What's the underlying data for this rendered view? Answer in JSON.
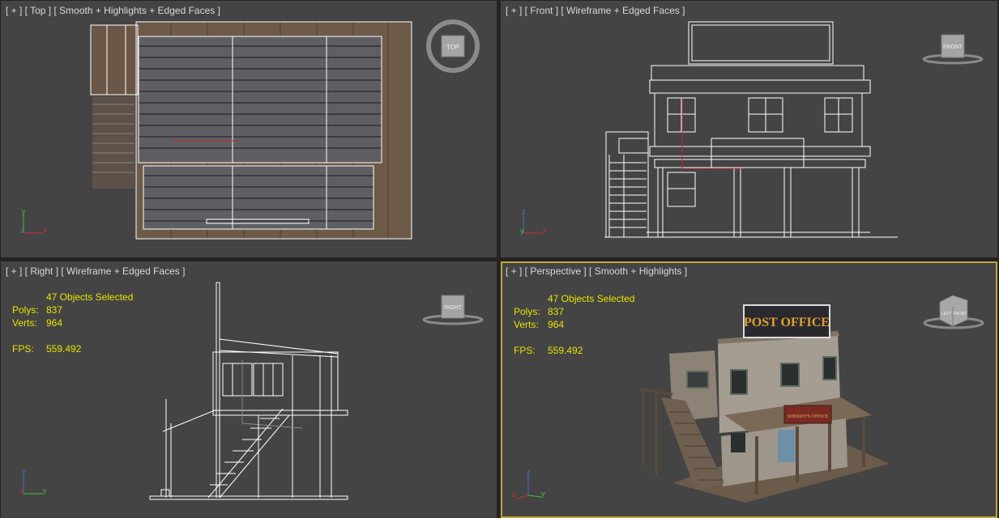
{
  "viewports": {
    "top": {
      "label": "[ + ] [ Top ] [ Smooth + Highlights + Edged Faces ]",
      "cube": "TOP"
    },
    "front": {
      "label": "[ + ] [ Front ] [ Wireframe + Edged Faces ]",
      "cube": "FRONT"
    },
    "right": {
      "label": "[ + ] [ Right ] [ Wireframe + Edged Faces ]",
      "cube": "RIGHT",
      "stats": {
        "selected": "47 Objects Selected",
        "polys_label": "Polys:",
        "polys": "837",
        "verts_label": "Verts:",
        "verts": "964",
        "fps_label": "FPS:",
        "fps": "559.492"
      }
    },
    "perspective": {
      "label": "[ + ] [ Perspective ] [ Smooth + Highlights ]",
      "cube_front": "FRONT",
      "cube_left": "LEFT",
      "stats": {
        "selected": "47 Objects Selected",
        "polys_label": "Polys:",
        "polys": "837",
        "verts_label": "Verts:",
        "verts": "964",
        "fps_label": "FPS:",
        "fps": "559.492"
      },
      "sign_post": "POST OFFICE",
      "sign_sheriff": "SHERIFF'S OFFICE"
    }
  },
  "axes": {
    "x": "x",
    "y": "y",
    "z": "z"
  },
  "colors": {
    "viewport_bg": "#444444",
    "active_border": "#bfa43a",
    "stats_text": "#e6e400",
    "wire": "#ffffff"
  }
}
